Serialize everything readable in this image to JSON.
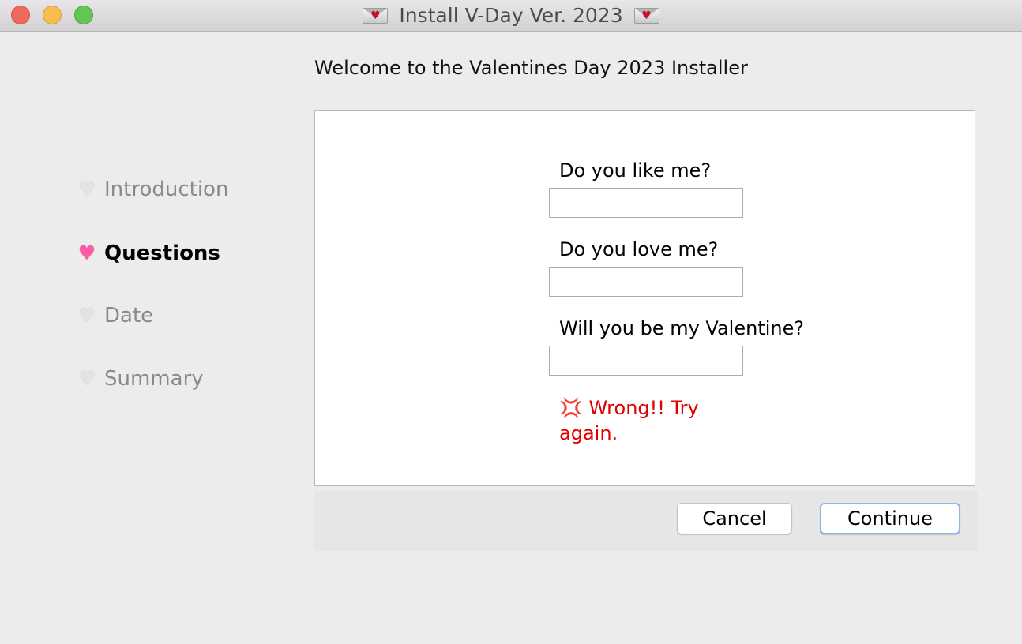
{
  "window": {
    "title": "Install V-Day Ver. 2023",
    "title_icon": "love-letter-icon"
  },
  "header": {
    "welcome": "Welcome to the Valentines Day 2023 Installer"
  },
  "sidebar": {
    "items": [
      {
        "label": "Introduction",
        "icon": "white-heart-icon",
        "state": "inactive"
      },
      {
        "label": "Questions",
        "icon": "sparkling-heart-icon",
        "state": "active"
      },
      {
        "label": "Date",
        "icon": "white-heart-icon",
        "state": "inactive"
      },
      {
        "label": "Summary",
        "icon": "white-heart-icon",
        "state": "inactive"
      }
    ]
  },
  "form": {
    "questions": [
      {
        "label": "Do you like me?",
        "value": ""
      },
      {
        "label": "Do you love me?",
        "value": ""
      },
      {
        "label": "Will you be my Valentine?",
        "value": ""
      }
    ],
    "error": "💢 Wrong!! Try again."
  },
  "buttons": {
    "cancel": "Cancel",
    "continue": "Continue"
  },
  "colors": {
    "error": "#e00000",
    "focus_ring": "#8fb5e8",
    "active_heart": "#ff5aa8"
  }
}
